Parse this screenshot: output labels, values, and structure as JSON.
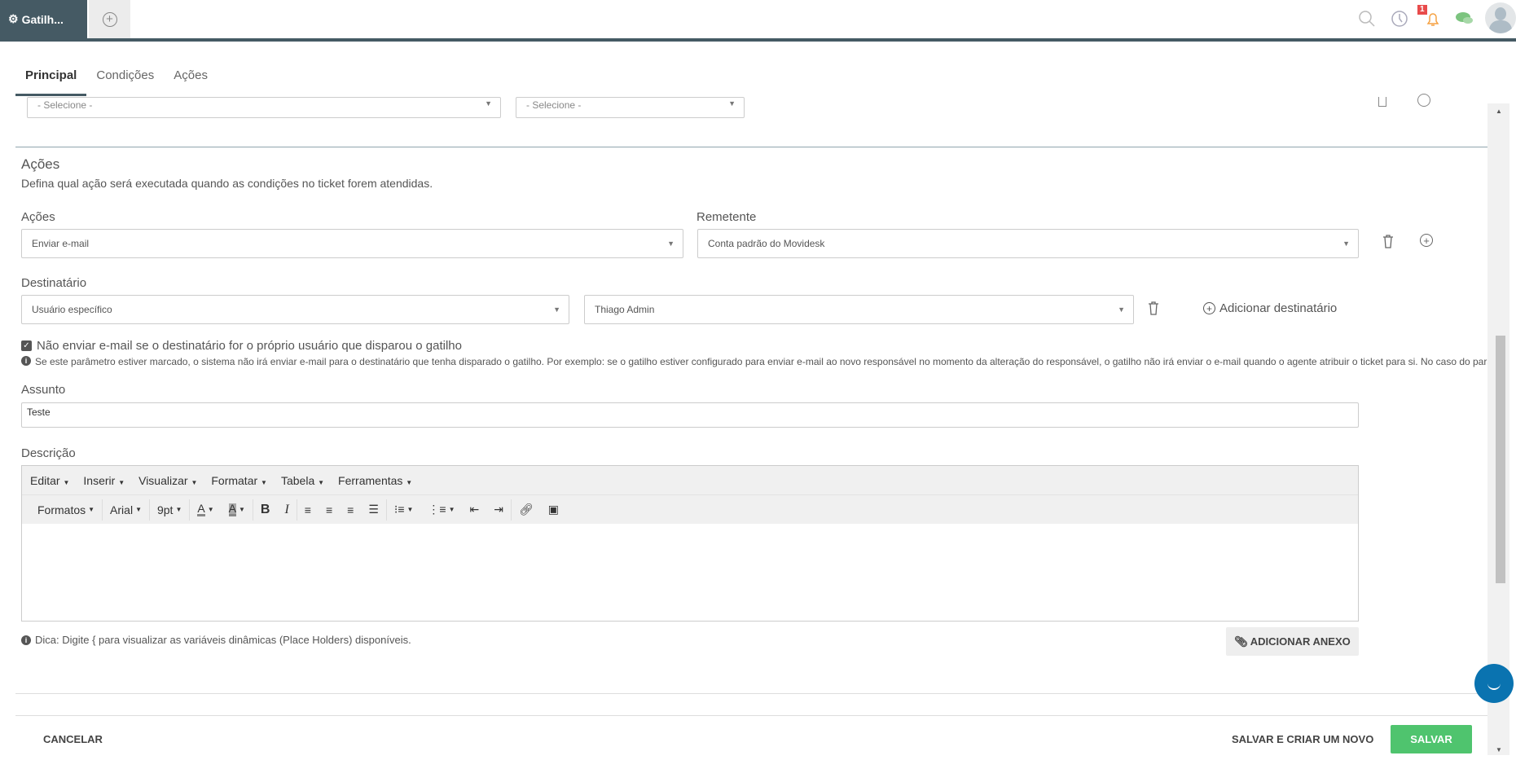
{
  "app_tab": {
    "label": "Gatilh..."
  },
  "header": {
    "notification_count": "1"
  },
  "tabs": [
    {
      "label": "Principal"
    },
    {
      "label": "Condições"
    },
    {
      "label": "Ações"
    }
  ],
  "top_selects": [
    "- Selecione -",
    "- Selecione -"
  ],
  "section": {
    "title": "Ações",
    "description": "Defina qual ação será executada quando as condições no ticket forem atendidas."
  },
  "acoes": {
    "label": "Ações",
    "value": "Enviar e-mail"
  },
  "remetente": {
    "label": "Remetente",
    "value": "Conta padrão do Movidesk"
  },
  "destinatario": {
    "label": "Destinatário",
    "type": "Usuário específico",
    "user": "Thiago Admin",
    "add_label": "Adicionar destinatário"
  },
  "checkbox": {
    "label": "Não enviar e-mail se o destinatário for o próprio usuário que disparou o gatilho",
    "checked": true,
    "info": "Se este parâmetro estiver marcado, o sistema não irá enviar e-mail para o destinatário que tenha disparado o gatilho. Por exemplo: se o gatilho estiver configurado para enviar e-mail ao novo responsável no momento da alteração do responsável, o gatilho não irá enviar o e-mail quando o agente atribuir o ticket para si. No caso do parâme"
  },
  "assunto": {
    "label": "Assunto",
    "value": "Teste"
  },
  "descricao": {
    "label": "Descrição"
  },
  "editor": {
    "menu": [
      "Editar",
      "Inserir",
      "Visualizar",
      "Formatar",
      "Tabela",
      "Ferramentas"
    ],
    "formats": "Formatos",
    "font": "Arial",
    "size": "9pt",
    "text_color": "A",
    "bg_color": "A",
    "bold": "B",
    "italic": "I"
  },
  "tip": "Dica: Digite { para visualizar as variáveis dinâmicas (Place Holders) disponíveis.",
  "attach_label": "ADICIONAR ANEXO",
  "footer": {
    "cancel": "CANCELAR",
    "save_new": "SALVAR E CRIAR UM NOVO",
    "save": "SALVAR"
  },
  "colors": {
    "primary": "#455a64",
    "save": "#4fc46e",
    "chat": "#0a73b0"
  }
}
